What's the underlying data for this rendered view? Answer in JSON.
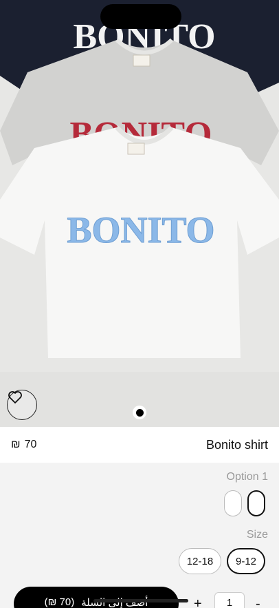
{
  "product": {
    "name": "Bonito shirt",
    "price": "70",
    "currency": "₪",
    "print_text": "BONITO"
  },
  "gallery": {
    "current_page": 1,
    "page_count": 1
  },
  "options": {
    "option1_label": "Option 1",
    "size_label": "Size",
    "sizes": [
      "12-18",
      "9-12"
    ],
    "selected_size": "9-12"
  },
  "cart": {
    "label": "أضف إلى السلة",
    "price_text": "(₪ 70)",
    "plus": "+",
    "minus": "-",
    "quantity": "1"
  },
  "colors": {
    "navy_shirt": "#1b2030",
    "grey_shirt": "#d2d2d0",
    "red_print": "#b52a3a",
    "blue_print": "#8bb8e8"
  }
}
